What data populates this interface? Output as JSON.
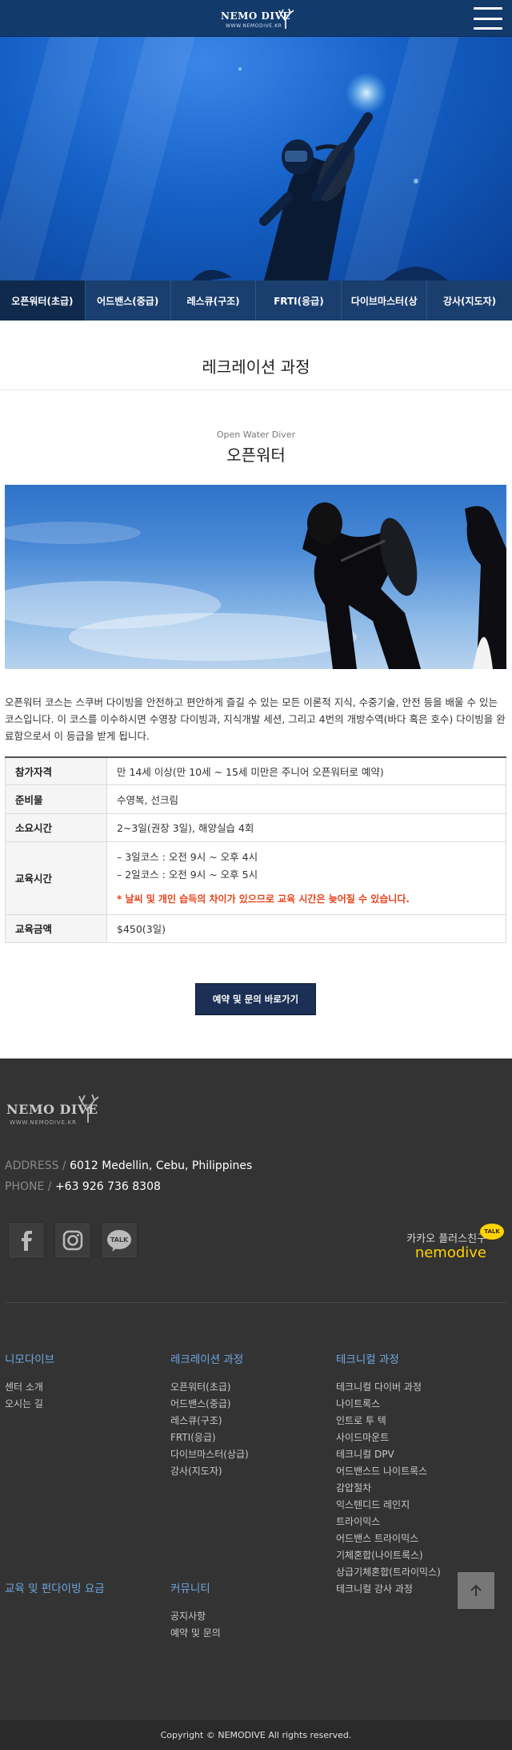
{
  "header": {
    "logo_text": "NEMO DIVE",
    "logo_sub": "WWW.NEMODIVE.KR",
    "menu_icon": "hamburger-menu-icon"
  },
  "hero": {
    "image": "scuba-diver-underwater-photo"
  },
  "tabs": [
    {
      "label": "오픈워터(초급)",
      "active": true
    },
    {
      "label": "어드밴스(중급)",
      "active": false
    },
    {
      "label": "레스큐(구조)",
      "active": false
    },
    {
      "label": "FRTI(응급)",
      "active": false
    },
    {
      "label": "다이브마스터(상",
      "active": false
    },
    {
      "label": "강사(지도자)",
      "active": false
    }
  ],
  "page": {
    "section_title": "레크레이션 과정",
    "subtitle_en": "Open Water Diver",
    "subtitle_ko": "오픈워터",
    "course_image": "diver-entering-water-photo",
    "description": "오픈워터 코스는 스쿠버 다이빙을 안전하고 편안하게 즐길 수 있는 모든 이론적 지식, 수중기술, 안전 등을 배울 수 있는 코스입니다. 이 코스를 이수하시면 수영장 다이빙과, 지식개발 세션, 그리고 4번의 개방수역(바다 혹은 호수) 다이빙을 완료함으로서 이 등급을 받게 됩니다."
  },
  "info": {
    "qualification": {
      "label": "참가자격",
      "value": "만 14세 이상(만 10세 ~ 15세 미만은 주니어 오픈워터로 예약)"
    },
    "supplies": {
      "label": "준비물",
      "value": "수영복, 선크림"
    },
    "duration": {
      "label": "소요시간",
      "value": "2~3일(권장 3일), 해양실습 4회"
    },
    "schedule": {
      "label": "교육시간",
      "line1": "– 3일코스 : 오전 9시 ~ 오후 4시",
      "line2": "– 2일코스 : 오전 9시 ~ 오후 5시",
      "warning": "* 날씨 및 개인 습득의 차이가 있으므로 교육 시간은 늦어질 수 있습니다."
    },
    "price": {
      "label": "교육금액",
      "value": "$450(3일)"
    }
  },
  "cta": {
    "label": "예약 및 문의 바로가기"
  },
  "footer": {
    "logo_text": "NEMO DIVE",
    "logo_sub": "WWW.NEMODIVE.KR",
    "address_label": "ADDRESS /",
    "address": "6012 Medellin, Cebu, Philippines",
    "phone_label": "PHONE /",
    "phone": "+63 926 736 8308",
    "sns": [
      "facebook-icon",
      "instagram-icon",
      "kakaotalk-icon"
    ],
    "kakao_line1": "카카오 플러스친구",
    "kakao_line2": "nemodive",
    "kakao_badge": "TALK",
    "sns_talk": "TALK",
    "columns": {
      "c1": {
        "title": "니모다이브",
        "links": [
          "센터 소개",
          "오시는 길"
        ]
      },
      "c2": {
        "title": "레크레이션 과정",
        "links": [
          "오픈워터(초급)",
          "어드밴스(중급)",
          "레스큐(구조)",
          "FRTI(응급)",
          "다이브마스터(상급)",
          "강사(지도자)"
        ]
      },
      "c3": {
        "title": "테크니컬 과정",
        "links": [
          "테크니컬 다이버 과정",
          "나이트록스",
          "인트로 투 텍",
          "사이드마운트",
          "테크니컬 DPV",
          "어드밴스드 나이트록스",
          "감압절차",
          "익스텐디드 레인지",
          "트라이믹스",
          "어드밴스 트라이믹스",
          "기체혼합(나이트록스)",
          "상급기체혼합(트라이믹스)",
          "테크니컬 강사 과정"
        ]
      },
      "c4": {
        "title": "교육 및 펀다이빙 요금",
        "links": []
      },
      "c5": {
        "title": "커뮤니티",
        "links": [
          "공지사항",
          "예약 및 문의"
        ]
      }
    },
    "to_top_icon": "arrow-up-icon",
    "copyright": "Copyright © NEMODIVE All rights reserved."
  },
  "colors": {
    "header": "#123a6b",
    "tabs": "#1a3e6e",
    "cta": "#1c2f55",
    "footer": "#333333",
    "accent_link": "#6fa7e0",
    "warning": "#e8431a",
    "kakao": "#ffd400"
  }
}
